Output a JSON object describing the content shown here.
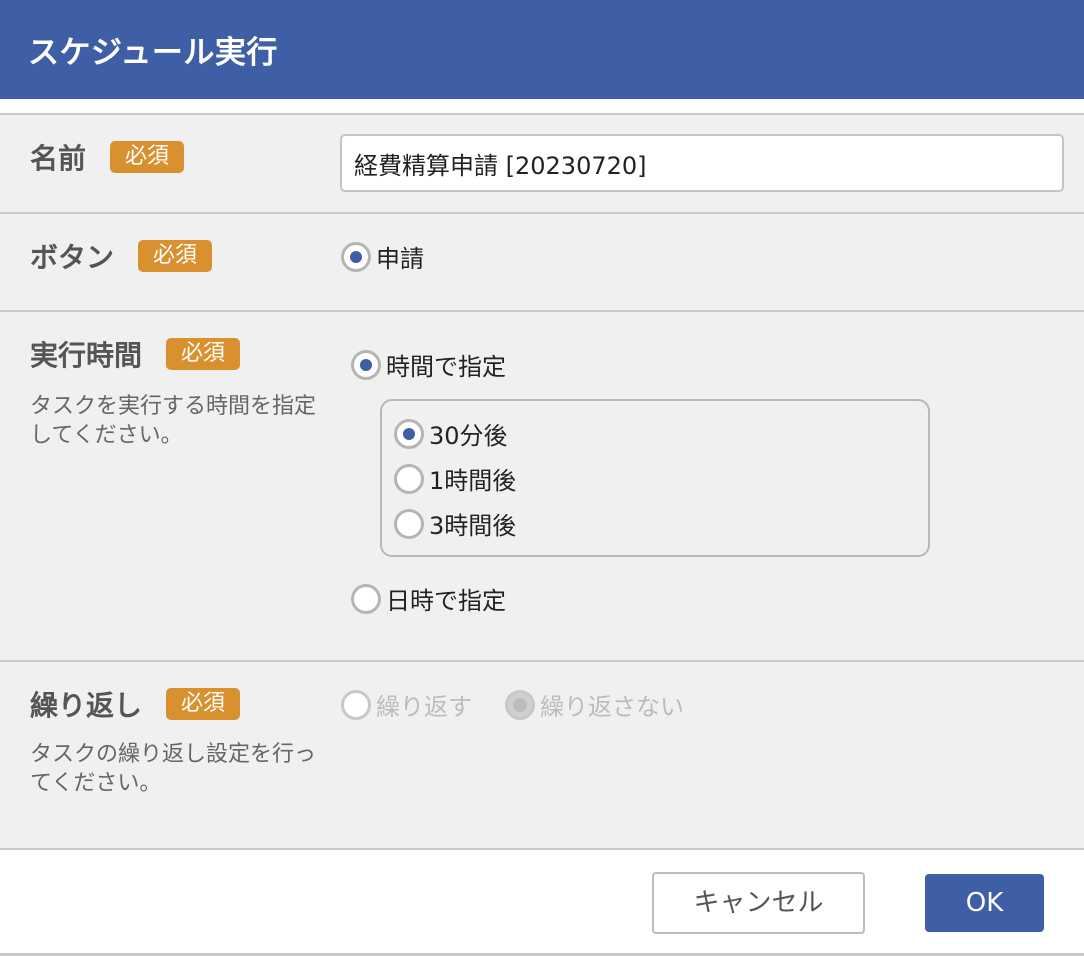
{
  "dialog": {
    "title": "スケジュール実行"
  },
  "required_badge": "必須",
  "name_field": {
    "label": "名前",
    "value": "経費精算申請 [20230720]"
  },
  "button_field": {
    "label": "ボタン",
    "options": [
      {
        "label": "申請",
        "checked": true
      }
    ]
  },
  "time_field": {
    "label": "実行時間",
    "description": "タスクを実行する時間を指定してください。",
    "options": [
      {
        "label": "時間で指定",
        "checked": true
      },
      {
        "label": "日時で指定",
        "checked": false
      }
    ],
    "sub_options": [
      {
        "label": "30分後",
        "checked": true
      },
      {
        "label": "1時間後",
        "checked": false
      },
      {
        "label": "3時間後",
        "checked": false
      }
    ]
  },
  "repeat_field": {
    "label": "繰り返し",
    "description": "タスクの繰り返し設定を行ってください。",
    "options": [
      {
        "label": "繰り返す",
        "checked": false,
        "disabled": true
      },
      {
        "label": "繰り返さない",
        "checked": true,
        "disabled": true
      }
    ]
  },
  "footer": {
    "cancel_label": "キャンセル",
    "ok_label": "OK"
  },
  "colors": {
    "primary": "#3e5fa6",
    "badge": "#d9902e",
    "background": "#f0f0f0"
  }
}
